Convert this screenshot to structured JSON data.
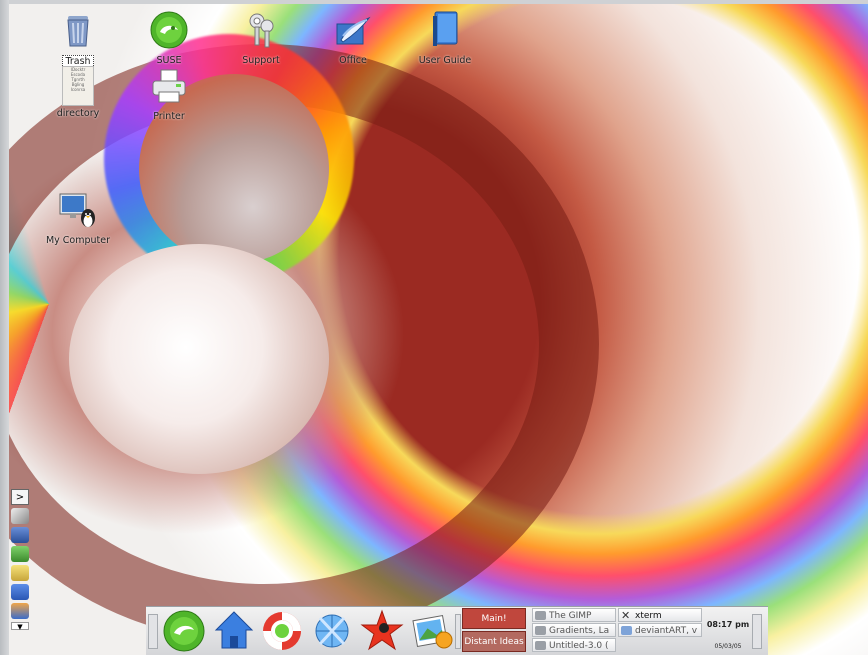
{
  "desktop_icons": [
    {
      "label": "Trash",
      "icon": "trash-icon"
    },
    {
      "label": "SUSE",
      "icon": "suse-icon"
    },
    {
      "label": "Support",
      "icon": "support-keys-icon"
    },
    {
      "label": "Office",
      "icon": "office-icon"
    },
    {
      "label": "User Guide",
      "icon": "user-guide-icon"
    },
    {
      "label": "directory",
      "icon": "directory-icon"
    },
    {
      "label": "Printer",
      "icon": "printer-icon"
    },
    {
      "label": "My Computer",
      "icon": "my-computer-icon"
    }
  ],
  "directory_preview_text": [
    "IDocktr",
    "Escoda",
    "Tgnrth",
    "Bgling",
    "Iconrsa"
  ],
  "side_dock": {
    "prompt_label": ">",
    "items": [
      "terminal-icon",
      "plug-icon",
      "network-icon",
      "chip-icon",
      "note-icon",
      "speaker-icon",
      "app-icon"
    ]
  },
  "panel": {
    "launchers": [
      "suse-menu-icon",
      "home-folder-icon",
      "help-lifebuoy-icon",
      "konqueror-globe-icon",
      "kde-star-icon",
      "image-viewer-icon"
    ],
    "pager": {
      "desk1": "Main!",
      "desk2": "Distant Ideas"
    },
    "tasks": [
      {
        "label": "The GIMP",
        "icon": "gimp-icon",
        "active": false
      },
      {
        "label": "xterm",
        "icon": "x-icon",
        "active": true
      },
      {
        "label": "Gradients, La",
        "icon": "gimp-icon",
        "active": false
      },
      {
        "label": "deviantART, v",
        "icon": "browser-icon",
        "active": false
      },
      {
        "label": "Untitled-3.0 (",
        "icon": "gimp-icon",
        "active": false
      }
    ],
    "clock": {
      "time": "08:17 pm",
      "date": "05/03/05"
    }
  }
}
